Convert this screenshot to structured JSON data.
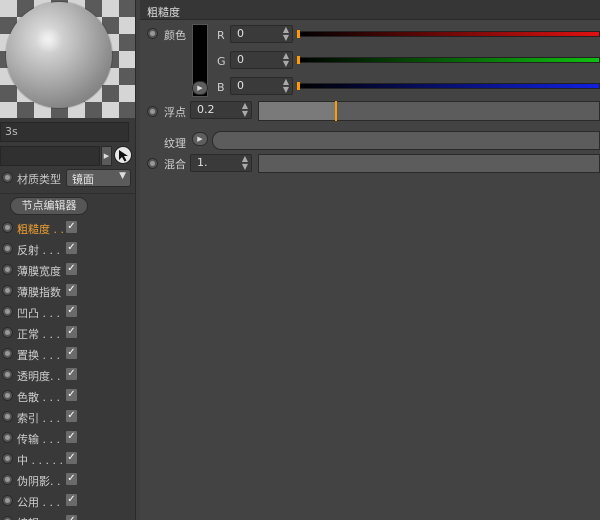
{
  "left_panel": {
    "time_field_value": "3s",
    "material_type_label": "材质类型",
    "material_type_value": "镜面",
    "node_editor_button": "节点编辑器",
    "channels": [
      {
        "name": "粗糙度 . .",
        "checked": "✓",
        "active": true
      },
      {
        "name": "反射 . . .",
        "checked": "✓",
        "active": false
      },
      {
        "name": "薄膜宽度",
        "checked": "✓",
        "active": false
      },
      {
        "name": "薄膜指数",
        "checked": "✓",
        "active": false
      },
      {
        "name": "凹凸 . . .",
        "checked": "✓",
        "active": false
      },
      {
        "name": "正常 . . .",
        "checked": "✓",
        "active": false
      },
      {
        "name": "置换 . . .",
        "checked": "✓",
        "active": false
      },
      {
        "name": "透明度. .",
        "checked": "✓",
        "active": false
      },
      {
        "name": "色散 . . .",
        "checked": "✓",
        "active": false
      },
      {
        "name": "索引 . . .",
        "checked": "✓",
        "active": false
      },
      {
        "name": "传输 . . .",
        "checked": "✓",
        "active": false
      },
      {
        "name": "中 . . . . . .",
        "checked": "✓",
        "active": false
      },
      {
        "name": "伪阴影. .",
        "checked": "✓",
        "active": false
      },
      {
        "name": "公用 . . .",
        "checked": "✓",
        "active": false
      },
      {
        "name": "编辑 . . .",
        "checked": "✓",
        "active": false
      }
    ]
  },
  "right_panel": {
    "section_title": "粗糙度",
    "color_label": "颜色",
    "color_value": "#000000",
    "channels": [
      {
        "label": "R",
        "value": "0",
        "gradient_end": "#e01010"
      },
      {
        "label": "G",
        "value": "0",
        "gradient_end": "#10c010"
      },
      {
        "label": "B",
        "value": "0",
        "gradient_end": "#1020e0"
      }
    ],
    "float_label": "浮点",
    "float_value": "0.2",
    "float_level": 0.2,
    "texture_label": "纹理",
    "mix_label": "混合",
    "mix_value": "1."
  },
  "colors": {
    "accent": "#ff9a00",
    "active_channel": "#f0a030"
  }
}
